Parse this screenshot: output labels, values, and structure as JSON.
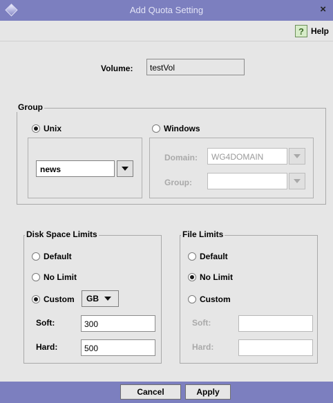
{
  "window": {
    "title": "Add Quota Setting",
    "close_glyph": "×",
    "app_icon": "diamond-icon"
  },
  "toolbar": {
    "help_glyph": "?",
    "help_label": "Help"
  },
  "volume": {
    "label": "Volume:",
    "value": "testVol"
  },
  "group": {
    "legend": "Group",
    "unix": {
      "label": "Unix",
      "selected": true,
      "group_value": "news"
    },
    "windows": {
      "label": "Windows",
      "selected": false,
      "domain_label": "Domain:",
      "domain_value": "WG4DOMAIN",
      "group_label": "Group:",
      "group_value": ""
    }
  },
  "disk_limits": {
    "legend": "Disk Space Limits",
    "options": [
      {
        "label": "Default",
        "selected": false
      },
      {
        "label": "No Limit",
        "selected": false
      },
      {
        "label": "Custom",
        "selected": true
      }
    ],
    "unit": "GB",
    "soft_label": "Soft:",
    "soft_value": "300",
    "hard_label": "Hard:",
    "hard_value": "500"
  },
  "file_limits": {
    "legend": "File Limits",
    "options": [
      {
        "label": "Default",
        "selected": false
      },
      {
        "label": "No Limit",
        "selected": true
      },
      {
        "label": "Custom",
        "selected": false
      }
    ],
    "soft_label": "Soft:",
    "soft_value": "",
    "hard_label": "Hard:",
    "hard_value": ""
  },
  "buttons": {
    "cancel": "Cancel",
    "apply": "Apply"
  },
  "colors": {
    "titlebar": "#7c7fbf",
    "background": "#e6e6e6"
  }
}
